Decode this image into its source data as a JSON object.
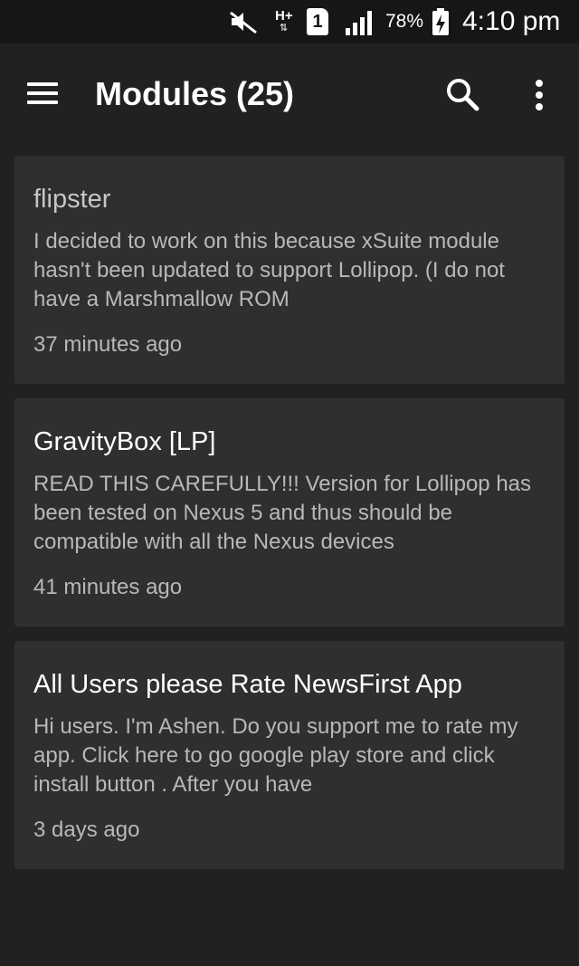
{
  "status_bar": {
    "network_type": "H+",
    "network_arrows": "⇅",
    "sim_slot": "1",
    "battery_percent": "78%",
    "time": "4:10 pm",
    "icons": [
      "mute-icon",
      "signal-icon",
      "battery-charging-icon"
    ]
  },
  "app_bar": {
    "title": "Modules (25)",
    "icons": [
      "menu-icon",
      "search-icon",
      "overflow-menu-icon"
    ]
  },
  "modules": [
    {
      "title": "flipster",
      "description": "I decided to work on this because xSuite module hasn't been updated to support Lollipop. (I do not have a Marshmallow ROM",
      "time": "37 minutes ago"
    },
    {
      "title": "GravityBox [LP]",
      "description": "READ THIS CAREFULLY!!! Version for Lollipop has been tested on Nexus 5 and thus should be compatible with all the Nexus devices",
      "time": "41 minutes ago"
    },
    {
      "title": "All Users please Rate NewsFirst App",
      "description": "Hi users. I'm Ashen. Do you support me to rate my app. Click here to go google play store and click install button . After you have",
      "time": "3 days ago"
    }
  ],
  "colors": {
    "background": "#212121",
    "status_bar": "#161616",
    "card": "#2f2f2f",
    "title_text": "#ffffff",
    "secondary_text": "#b8b8b8"
  }
}
